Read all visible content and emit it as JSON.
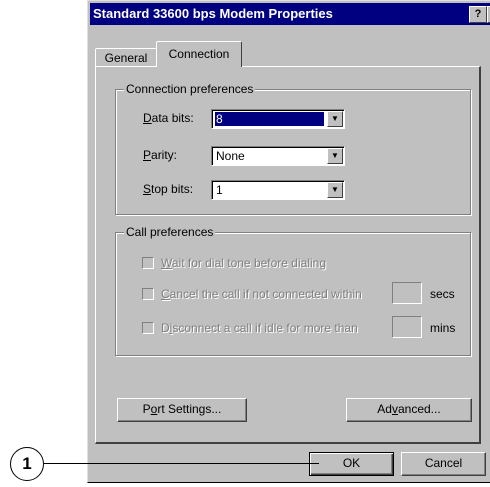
{
  "window": {
    "title": "Standard 33600 bps Modem Properties",
    "help_glyph": "?",
    "close_glyph": "×"
  },
  "tabs": [
    {
      "label": "General",
      "active": false
    },
    {
      "label": "Connection",
      "active": true
    }
  ],
  "connection_preferences": {
    "title": "Connection preferences",
    "data_bits": {
      "label_pre": "",
      "label_u": "D",
      "label_post": "ata bits:",
      "value": "8"
    },
    "parity": {
      "label_pre": "",
      "label_u": "P",
      "label_post": "arity:",
      "value": "None"
    },
    "stop_bits": {
      "label_pre": "",
      "label_u": "S",
      "label_post": "top bits:",
      "value": "1"
    }
  },
  "call_preferences": {
    "title": "Call preferences",
    "wait_dial_tone": {
      "label_pre": "",
      "label_u": "W",
      "label_post": "ait for dial tone before dialing",
      "checked": false,
      "enabled": false
    },
    "cancel_call": {
      "label_pre": "",
      "label_u": "C",
      "label_post": "ancel the call if not connected within",
      "unit": "secs",
      "value": "",
      "checked": false,
      "enabled": false
    },
    "disconnect_idle": {
      "label_pre": "D",
      "label_u": "i",
      "label_post": "sconnect a call if idle for more than",
      "unit": "mins",
      "value": "",
      "checked": false,
      "enabled": false
    }
  },
  "buttons": {
    "port_settings": {
      "pre": "P",
      "u": "o",
      "post": "rt Settings..."
    },
    "advanced": {
      "pre": "Ad",
      "u": "v",
      "post": "anced..."
    },
    "ok": "OK",
    "cancel": "Cancel"
  },
  "callout": {
    "number": "1"
  },
  "icons": {
    "dropdown": "chevron-down-icon",
    "help": "help-icon",
    "close": "close-icon"
  }
}
